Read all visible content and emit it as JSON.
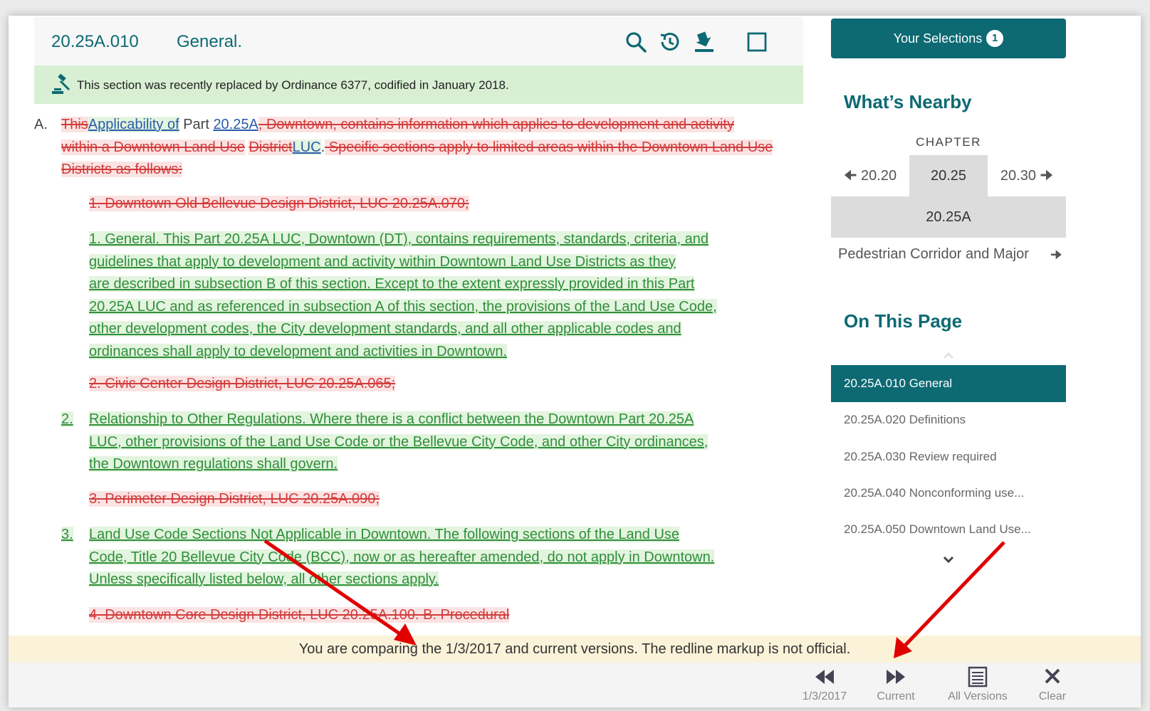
{
  "header": {
    "section_number": "20.25A.010",
    "section_title": "General.",
    "tools": [
      "search-icon",
      "timeline-icon",
      "download-icon",
      "checkbox-icon"
    ]
  },
  "notice": {
    "text": "This section was recently replaced by Ordinance 6377, codified in January 2018."
  },
  "content": {
    "a_marker": "A.",
    "a_del1": "This",
    "a_ins1": "Applicability of",
    "a_plain1": " Part ",
    "a_link1": "20.25A",
    "a_del2": ", Downtown, contains information which applies to development and activity within a Downtown Land Use",
    "a_sp": " ",
    "a_del3": "District",
    "a_ins2": "LUC",
    "a_plain2": ".",
    "a_del4": " Specific sections apply to limited areas within the Downtown Land Use Districts as follows:",
    "del_1": "1. Downtown Old Bellevue Design District, LUC 20.25A.070;",
    "ins_1_line1": "1. General. This Part 20.25A LUC, Downtown (DT), contains requirements, standards, criteria, and",
    "ins_1_line2": "guidelines that apply to development and activity within Downtown Land Use Districts as they",
    "ins_1_line3": "are described in subsection B of this section. Except to the extent expressly provided in this Part",
    "ins_1_line4": "20.25A LUC and as referenced in subsection A of this section, the provisions of the Land Use Code,",
    "ins_1_line5": "other development codes, the City development standards, and all other applicable codes and",
    "ins_1_line6": "ordinances shall apply to development and activities in Downtown.",
    "del_2": "2. Civic Center Design District, LUC 20.25A.065;",
    "ins_2_marker": "2.",
    "ins_2_line1": "Relationship to Other Regulations. Where there is a conflict between the Downtown Part 20.25A",
    "ins_2_line2": "LUC, other provisions of the Land Use Code or the Bellevue City Code, and other City ordinances,",
    "ins_2_line3": "the Downtown regulations shall govern.",
    "del_3": "3. Perimeter Design District, LUC 20.25A.090;",
    "ins_3_marker": "3.",
    "ins_3_line1": "Land Use Code Sections Not Applicable in Downtown. The following sections of the Land Use",
    "ins_3_line2": "Code, Title 20 Bellevue City Code (BCC), now or as hereafter amended, do not apply in Downtown.",
    "ins_3_line3": "Unless specifically listed below, all other sections apply.",
    "del_4": "4. Downtown Core Design District, LUC 20.25A.100. B. Procedural"
  },
  "sidebar": {
    "selections_label": "Your Selections",
    "selections_count": "1",
    "nearby_heading": "What’s Nearby",
    "chapter_label": "CHAPTER",
    "prev_chapter": "20.20",
    "current_chapter": "20.25",
    "next_chapter": "20.30",
    "current_part": "20.25A",
    "nearby_link": "Pedestrian Corridor and Major",
    "on_page_heading": "On This Page",
    "toc": [
      "20.25A.010 General",
      "20.25A.020 Definitions",
      "20.25A.030 Review required",
      "20.25A.040 Nonconforming use...",
      "20.25A.050 Downtown Land Use..."
    ]
  },
  "compare_bar": {
    "text": "You are comparing the 1/3/2017 and current versions. The redline markup is not official."
  },
  "bottom_buttons": {
    "prev_label": "1/3/2017",
    "current_label": "Current",
    "all_label": "All Versions",
    "clear_label": "Clear"
  },
  "colors": {
    "accent": "#0d6a73",
    "deleted": "#d23b3b",
    "inserted": "#2f8f3a",
    "notice_bg": "#d8efd3",
    "compare_bg": "#faf3d9"
  }
}
